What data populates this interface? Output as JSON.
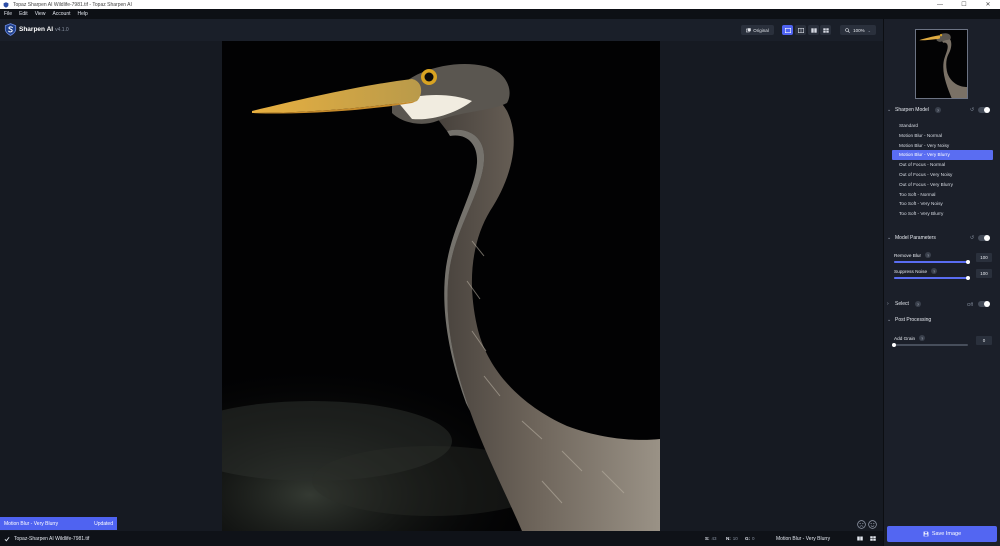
{
  "window": {
    "title": "Topaz Sharpen AI Wildlife-7981.tif - Topaz Sharpen AI",
    "minimize": "—",
    "maximize": "☐",
    "close": "✕"
  },
  "menu": [
    "File",
    "Edit",
    "View",
    "Account",
    "Help"
  ],
  "toolbar": {
    "app_name": "Sharpen AI",
    "version": "v4.1.0",
    "original_label": "Original",
    "zoom_label": "100%"
  },
  "toast": {
    "model": "Motion Blur - Very Blurry",
    "status": "Updated"
  },
  "statusbar": {
    "filename": "Topaz-Sharpen AI Wildlife-7981.tif",
    "s_label": "S:",
    "s_value": "43",
    "n_label": "N:",
    "n_value": "10",
    "g_label": "G:",
    "g_value": "0",
    "model": "Motion Blur - Very Blurry"
  },
  "panel": {
    "sharpen_model": {
      "title": "Sharpen Model",
      "help": "?",
      "reset": "↺",
      "items": [
        "Standard",
        "Motion Blur - Normal",
        "Motion Blur - Very Noisy",
        "Motion Blur - Very Blurry",
        "Out of Focus - Normal",
        "Out of Focus - Very Noisy",
        "Out of Focus - Very Blurry",
        "Too Soft - Normal",
        "Too Soft - Very Noisy",
        "Too Soft - Very Blurry"
      ],
      "selected_index": 3
    },
    "model_parameters": {
      "title": "Model Parameters",
      "reset": "↺",
      "params": [
        {
          "label": "Remove Blur",
          "help": "?",
          "value": "100",
          "fraction": 1.0
        },
        {
          "label": "Suppress Noise",
          "help": "?",
          "value": "100",
          "fraction": 1.0
        }
      ]
    },
    "select": {
      "title": "Select",
      "help": "?",
      "state": "Off"
    },
    "post_processing": {
      "title": "Post Processing",
      "params": [
        {
          "label": "Add Grain",
          "help": "?",
          "value": "0",
          "fraction": 0.0
        }
      ]
    },
    "save_label": "Save Image"
  },
  "icons": {
    "app": "topaz-shield-icon",
    "logo": "sharpen-s-logo-icon",
    "original": "compare-icon",
    "zoom": "magnifier-icon",
    "feedback_sad": "sad-face-icon",
    "feedback_happy": "happy-face-icon",
    "check": "check-icon",
    "save": "save-icon"
  },
  "colors": {
    "accent": "#5366f2",
    "background": "#161a22",
    "panel": "#1b1f29"
  }
}
